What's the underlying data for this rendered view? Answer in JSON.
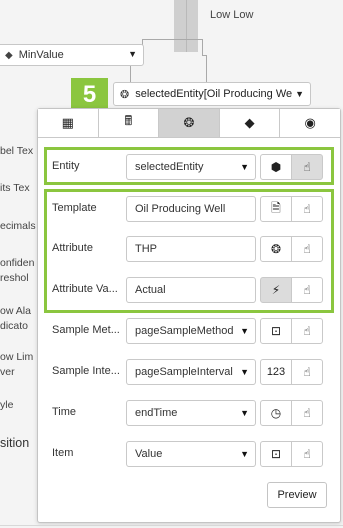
{
  "background": {
    "top_label": "Low Low",
    "min_value_dropdown": {
      "tag_icon": "tag-icon",
      "value": "MinValue"
    },
    "left_labels": [
      "bel Tex",
      "its Tex",
      "ecimals",
      "onfiden",
      "reshol",
      "ow Ala",
      "dicato",
      "ow Lim",
      "ver",
      "yle",
      "sition"
    ]
  },
  "step_badge": "5",
  "selected_entity_dropdown": {
    "icon": "atom-icon",
    "value": "selectedEntity[Oil Producing We"
  },
  "tabs": [
    {
      "name": "table-icon",
      "glyph": "▦"
    },
    {
      "name": "calculator-icon",
      "glyph": "🖩"
    },
    {
      "name": "element-icon",
      "glyph": "❂"
    },
    {
      "name": "tag-icon",
      "glyph": "◆"
    },
    {
      "name": "target-icon",
      "glyph": "◉"
    }
  ],
  "rows": {
    "entity": {
      "label": "Entity",
      "value": "selectedEntity"
    },
    "template": {
      "label": "Template",
      "value": "Oil Producing Well"
    },
    "attribute": {
      "label": "Attribute",
      "value": "THP"
    },
    "attribute_value": {
      "label": "Attribute Va...",
      "value": "Actual"
    },
    "sample_method": {
      "label": "Sample Met...",
      "value": "pageSampleMethod"
    },
    "sample_interval": {
      "label": "Sample Inte...",
      "value": "pageSampleInterval",
      "extra": "123"
    },
    "time": {
      "label": "Time",
      "value": "endTime"
    },
    "item": {
      "label": "Item",
      "value": "Value"
    }
  },
  "preview_button": "Preview",
  "colors": {
    "accent_green": "#8bc63f",
    "active_tab": "#d2d2d2"
  }
}
